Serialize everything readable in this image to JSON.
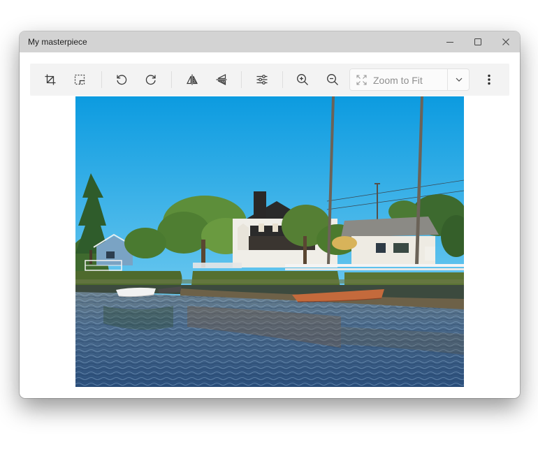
{
  "window": {
    "title": "My masterpiece"
  },
  "titlebar_controls": [
    {
      "name": "minimize",
      "icon": "minimize-icon"
    },
    {
      "name": "maximize",
      "icon": "maximize-icon"
    },
    {
      "name": "close",
      "icon": "close-icon"
    }
  ],
  "toolbar": {
    "tools": [
      {
        "name": "crop",
        "icon": "crop-icon"
      },
      {
        "name": "select",
        "icon": "select-icon"
      },
      {
        "name": "rotate-left",
        "icon": "rotate-left-icon"
      },
      {
        "name": "rotate-right",
        "icon": "rotate-right-icon"
      },
      {
        "name": "flip-horizontal",
        "icon": "flip-horizontal-icon"
      },
      {
        "name": "flip-vertical",
        "icon": "flip-vertical-icon"
      },
      {
        "name": "adjustments",
        "icon": "adjustments-icon"
      },
      {
        "name": "zoom-in",
        "icon": "zoom-in-icon"
      },
      {
        "name": "zoom-out",
        "icon": "zoom-out-icon"
      },
      {
        "name": "more",
        "icon": "more-vertical-icon"
      }
    ],
    "zoom": {
      "label": "Zoom to Fit",
      "icon": "fit-screen-icon",
      "dropdown_icon": "chevron-down-icon"
    }
  },
  "colors": {
    "titlebar": "#d3d3d3",
    "toolbar": "#f3f3f3",
    "icon": "#3a3a3a",
    "zoom_text": "#8f8f8f",
    "sky_top": "#0c9be0",
    "sky_bottom": "#6fcaf0",
    "water": "#3a5f88"
  }
}
